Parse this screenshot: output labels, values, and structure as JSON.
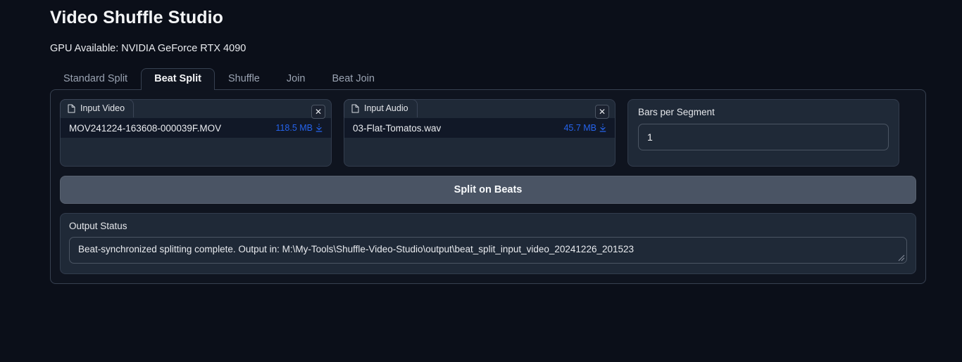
{
  "header": {
    "title": "Video Shuffle Studio",
    "gpu_status": "GPU Available: NVIDIA GeForce RTX 4090"
  },
  "tabs": [
    {
      "label": "Standard Split",
      "active": false
    },
    {
      "label": "Beat Split",
      "active": true
    },
    {
      "label": "Shuffle",
      "active": false
    },
    {
      "label": "Join",
      "active": false
    },
    {
      "label": "Beat Join",
      "active": false
    }
  ],
  "panels": {
    "input_video": {
      "tab_label": "Input Video",
      "icon": "file-icon",
      "clear_icon": "close-icon",
      "file_name": "MOV241224-163608-000039F.MOV",
      "file_size": "118.5 MB",
      "download_icon": "download-icon"
    },
    "input_audio": {
      "tab_label": "Input Audio",
      "icon": "file-icon",
      "clear_icon": "close-icon",
      "file_name": "03-Flat-Tomatos.wav",
      "file_size": "45.7 MB",
      "download_icon": "download-icon"
    },
    "bars_per_segment": {
      "label": "Bars per Segment",
      "value": "1"
    }
  },
  "actions": {
    "split_on_beats": "Split on Beats"
  },
  "output": {
    "label": "Output Status",
    "text": "Beat-synchronized splitting complete. Output in: M:\\My-Tools\\Shuffle-Video-Studio\\output\\beat_split_input_video_20241226_201523"
  },
  "colors": {
    "page_bg": "#0b0f19",
    "card_bg": "#0f141f",
    "panel_bg": "#1f2937",
    "row_bg": "#111827",
    "accent_link": "#2563eb",
    "button_bg": "#4a5464",
    "border": "#374151",
    "text": "#e5e7eb",
    "muted_text": "#9aa3b2"
  }
}
